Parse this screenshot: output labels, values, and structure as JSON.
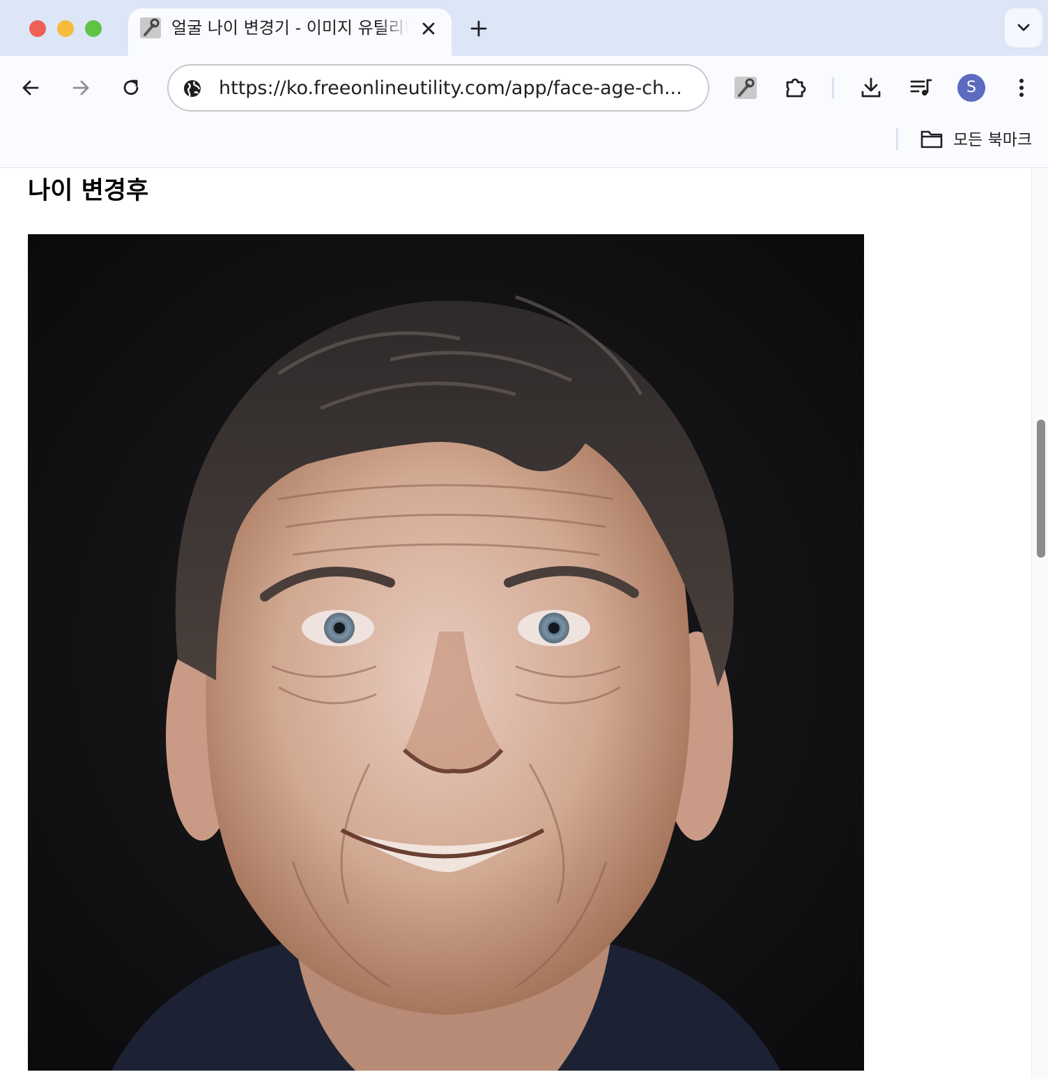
{
  "tab": {
    "title": "얼굴 나이 변경기 - 이미지 유틸리티",
    "favicon": "wrench-icon"
  },
  "toolbar": {
    "url": "https://ko.freeonlineutility.com/app/face-age-ch...",
    "profile_initial": "S"
  },
  "bookmarks": {
    "all_bookmarks_label": "모든 북마크"
  },
  "page": {
    "heading": "나이 변경후",
    "image_alt": "나이 변경후"
  },
  "colors": {
    "tabstrip_bg": "#dce6f7",
    "toolbar_bg": "#fafbff",
    "avatar": "#5c6bc0"
  }
}
